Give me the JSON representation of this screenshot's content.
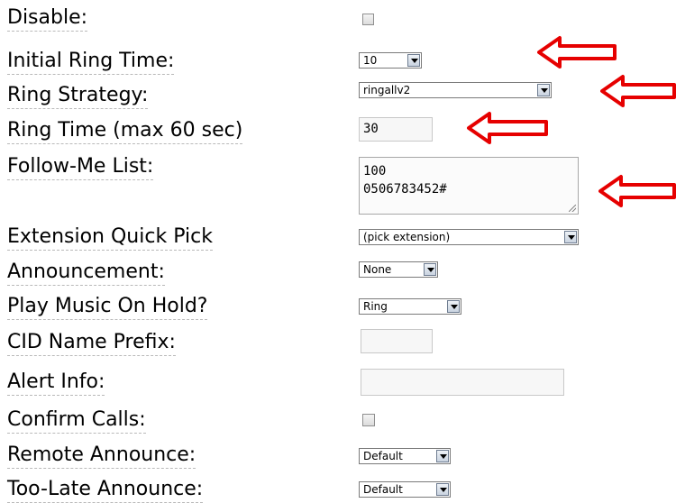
{
  "form": {
    "disable": {
      "label": "Disable:",
      "checked": false
    },
    "initial_ring_time": {
      "label": "Initial Ring Time:",
      "value": "10"
    },
    "ring_strategy": {
      "label": "Ring Strategy:",
      "value": "ringallv2"
    },
    "ring_time": {
      "label": "Ring Time (max 60 sec)",
      "value": "30"
    },
    "follow_me_list": {
      "label": "Follow-Me List:",
      "line1": "100",
      "line2": "0506783452#"
    },
    "extension_quick_pick": {
      "label": "Extension Quick Pick",
      "value": "(pick extension)"
    },
    "announcement": {
      "label": "Announcement:",
      "value": "None"
    },
    "play_moh": {
      "label": "Play Music On Hold?",
      "value": "Ring"
    },
    "cid_name_prefix": {
      "label": "CID Name Prefix:",
      "value": ""
    },
    "alert_info": {
      "label": "Alert Info:",
      "value": ""
    },
    "confirm_calls": {
      "label": "Confirm Calls:",
      "checked": false
    },
    "remote_announce": {
      "label": "Remote Announce:",
      "value": "Default"
    },
    "too_late_announce": {
      "label": "Too-Late Announce:",
      "value": "Default"
    }
  },
  "annotations": {
    "arrow_color": "#e60000",
    "arrow_count": 4
  }
}
